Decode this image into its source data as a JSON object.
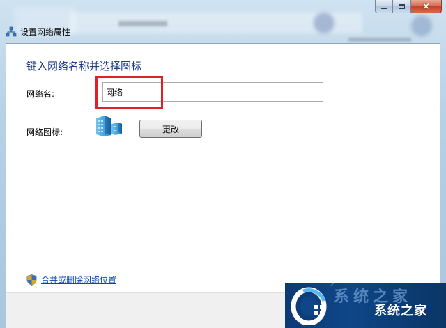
{
  "window": {
    "title": "设置网络属性",
    "caption_buttons": {
      "minimize": "minimize",
      "maximize": "maximize",
      "close": "×"
    }
  },
  "main": {
    "heading": "键入网络名称并选择图标",
    "name_label": "网络名:",
    "name_value": "网络",
    "icon_label": "网络图标:",
    "change_button": "更改",
    "merge_link": "合并或删除网络位置"
  },
  "watermark": {
    "text": "系统之家",
    "top_text": "系统之家"
  },
  "colors": {
    "heading": "#1e3c8c",
    "link": "#0645ad",
    "highlight": "#e0212a"
  },
  "icons": [
    "network-icon",
    "computer-building-icon",
    "shield-icon",
    "logo-icon"
  ]
}
